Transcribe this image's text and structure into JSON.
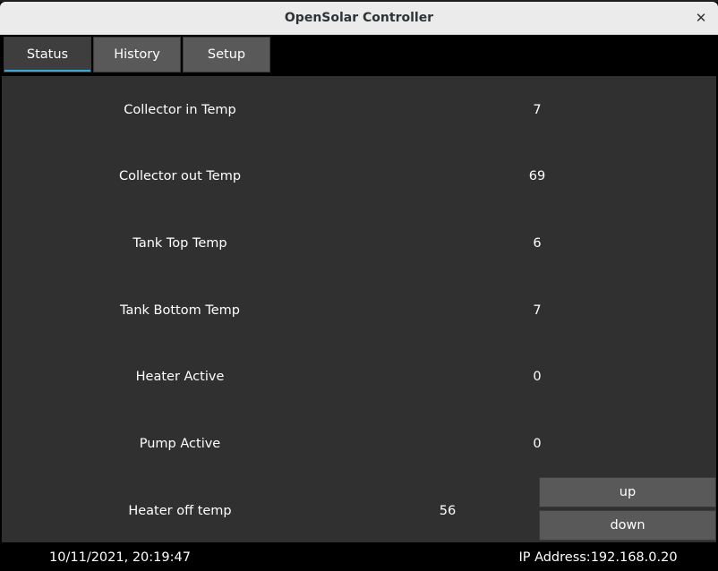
{
  "window": {
    "title": "OpenSolar Controller",
    "close_glyph": "✕"
  },
  "tabs": [
    {
      "label": "Status",
      "active": true
    },
    {
      "label": "History",
      "active": false
    },
    {
      "label": "Setup",
      "active": false
    }
  ],
  "status": {
    "rows": [
      {
        "label": "Collector in Temp",
        "value": "7"
      },
      {
        "label": "Collector out Temp",
        "value": "69"
      },
      {
        "label": "Tank Top Temp",
        "value": "6"
      },
      {
        "label": "Tank Bottom Temp",
        "value": "7"
      },
      {
        "label": "Heater Active",
        "value": "0"
      },
      {
        "label": "Pump Active",
        "value": "0"
      },
      {
        "label": "Heater off temp",
        "value": "56"
      }
    ],
    "up_label": "up",
    "down_label": "down"
  },
  "statusbar": {
    "datetime": "10/11/2021, 20:19:47",
    "ip": "IP Address:192.168.0.20"
  },
  "colors": {
    "panel_bg": "#303030",
    "button_bg": "#595959",
    "active_tab_accent": "#3aa9d8",
    "text": "#ffffff"
  }
}
